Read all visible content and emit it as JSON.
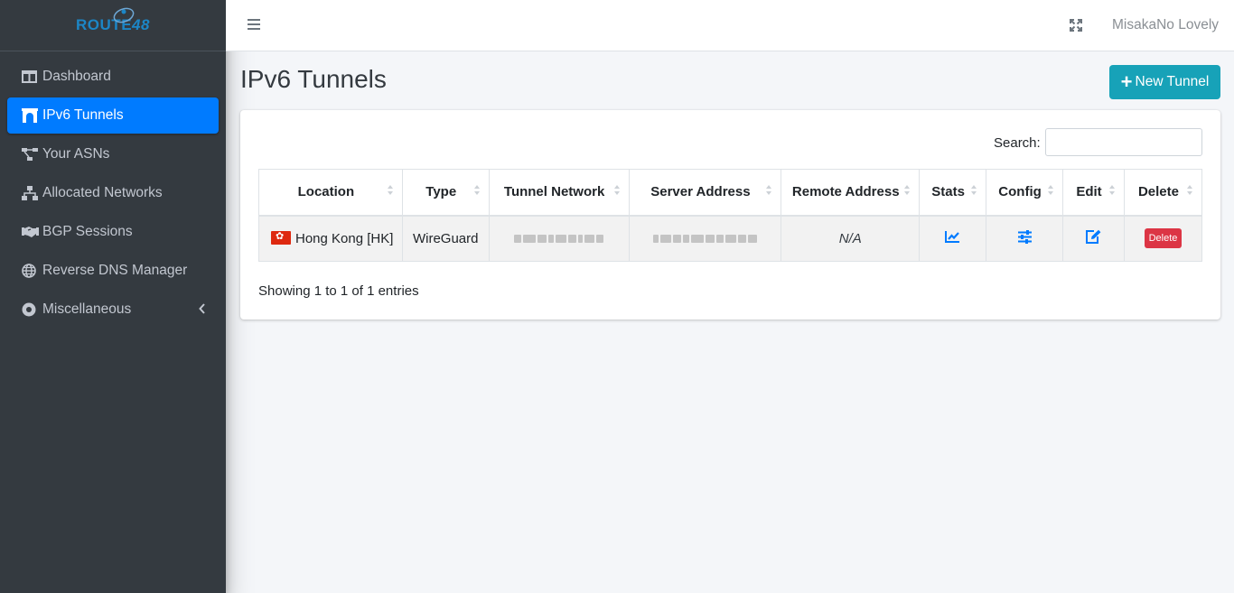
{
  "brand": {
    "name": "ROUTE",
    "suffix": "48"
  },
  "sidebar": {
    "items": [
      {
        "label": "Dashboard",
        "icon": "columns-icon",
        "active": false
      },
      {
        "label": "IPv6 Tunnels",
        "icon": "archway-icon",
        "active": true
      },
      {
        "label": "Your ASNs",
        "icon": "project-diagram-icon",
        "active": false
      },
      {
        "label": "Allocated Networks",
        "icon": "network-wired-icon",
        "active": false
      },
      {
        "label": "BGP Sessions",
        "icon": "handshake-icon",
        "active": false
      },
      {
        "label": "Reverse DNS Manager",
        "icon": "globe-icon",
        "active": false
      },
      {
        "label": "Miscellaneous",
        "icon": "dot-circle-icon",
        "active": false,
        "has_submenu": true
      }
    ]
  },
  "topbar": {
    "menu_icon": "bars-icon",
    "fullscreen_icon": "expand-icon",
    "username": "MisakaNo Lovely"
  },
  "page": {
    "title": "IPv6 Tunnels",
    "new_button": "New Tunnel"
  },
  "table": {
    "search_label": "Search:",
    "search_value": "",
    "columns": [
      "Location",
      "Type",
      "Tunnel Network",
      "Server Address",
      "Remote Address",
      "Stats",
      "Config",
      "Edit",
      "Delete"
    ],
    "rows": [
      {
        "location": "Hong Kong [HK]",
        "type": "WireGuard",
        "remote_address": "N/A",
        "delete_label": "Delete"
      }
    ],
    "footer": "Showing 1 to 1 of 1 entries"
  },
  "colors": {
    "sidebar_bg": "#343a40",
    "active": "#007bff",
    "info_button": "#17a2b8",
    "danger": "#dc3545",
    "action_icon": "#007bff"
  }
}
